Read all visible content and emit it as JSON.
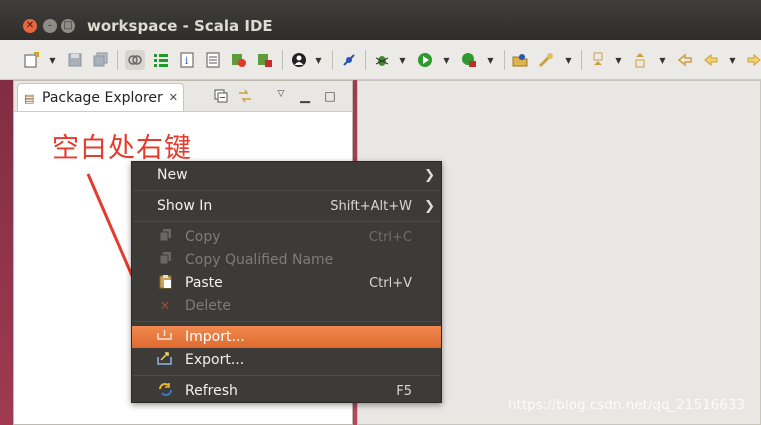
{
  "window": {
    "title": "workspace - Scala IDE"
  },
  "view": {
    "tab_label": "Package Explorer"
  },
  "annotation": {
    "text": "空白处右键"
  },
  "context_menu": {
    "items": [
      {
        "label": "New",
        "shortcut": "",
        "submenu": true,
        "icon": "",
        "enabled": true
      },
      {
        "label": "Show In",
        "shortcut": "Shift+Alt+W",
        "submenu": true,
        "icon": "",
        "enabled": true
      },
      {
        "label": "Copy",
        "shortcut": "Ctrl+C",
        "submenu": false,
        "icon": "copy-icon",
        "enabled": false
      },
      {
        "label": "Copy Qualified Name",
        "shortcut": "",
        "submenu": false,
        "icon": "copy-qualified-name-icon",
        "enabled": false
      },
      {
        "label": "Paste",
        "shortcut": "Ctrl+V",
        "submenu": false,
        "icon": "paste-icon",
        "enabled": true
      },
      {
        "label": "Delete",
        "shortcut": "",
        "submenu": false,
        "icon": "delete-icon",
        "enabled": false
      },
      {
        "label": "Import...",
        "shortcut": "",
        "submenu": false,
        "icon": "import-icon",
        "enabled": true,
        "highlighted": true
      },
      {
        "label": "Export...",
        "shortcut": "",
        "submenu": false,
        "icon": "export-icon",
        "enabled": true
      },
      {
        "label": "Refresh",
        "shortcut": "F5",
        "submenu": false,
        "icon": "refresh-icon",
        "enabled": true
      }
    ]
  },
  "watermark": {
    "text": "https://blog.csdn.net/qq_21516633"
  },
  "colors": {
    "highlight": "#e97a3d",
    "menu_bg": "#3c3b37",
    "annotation": "#e53b2c"
  }
}
